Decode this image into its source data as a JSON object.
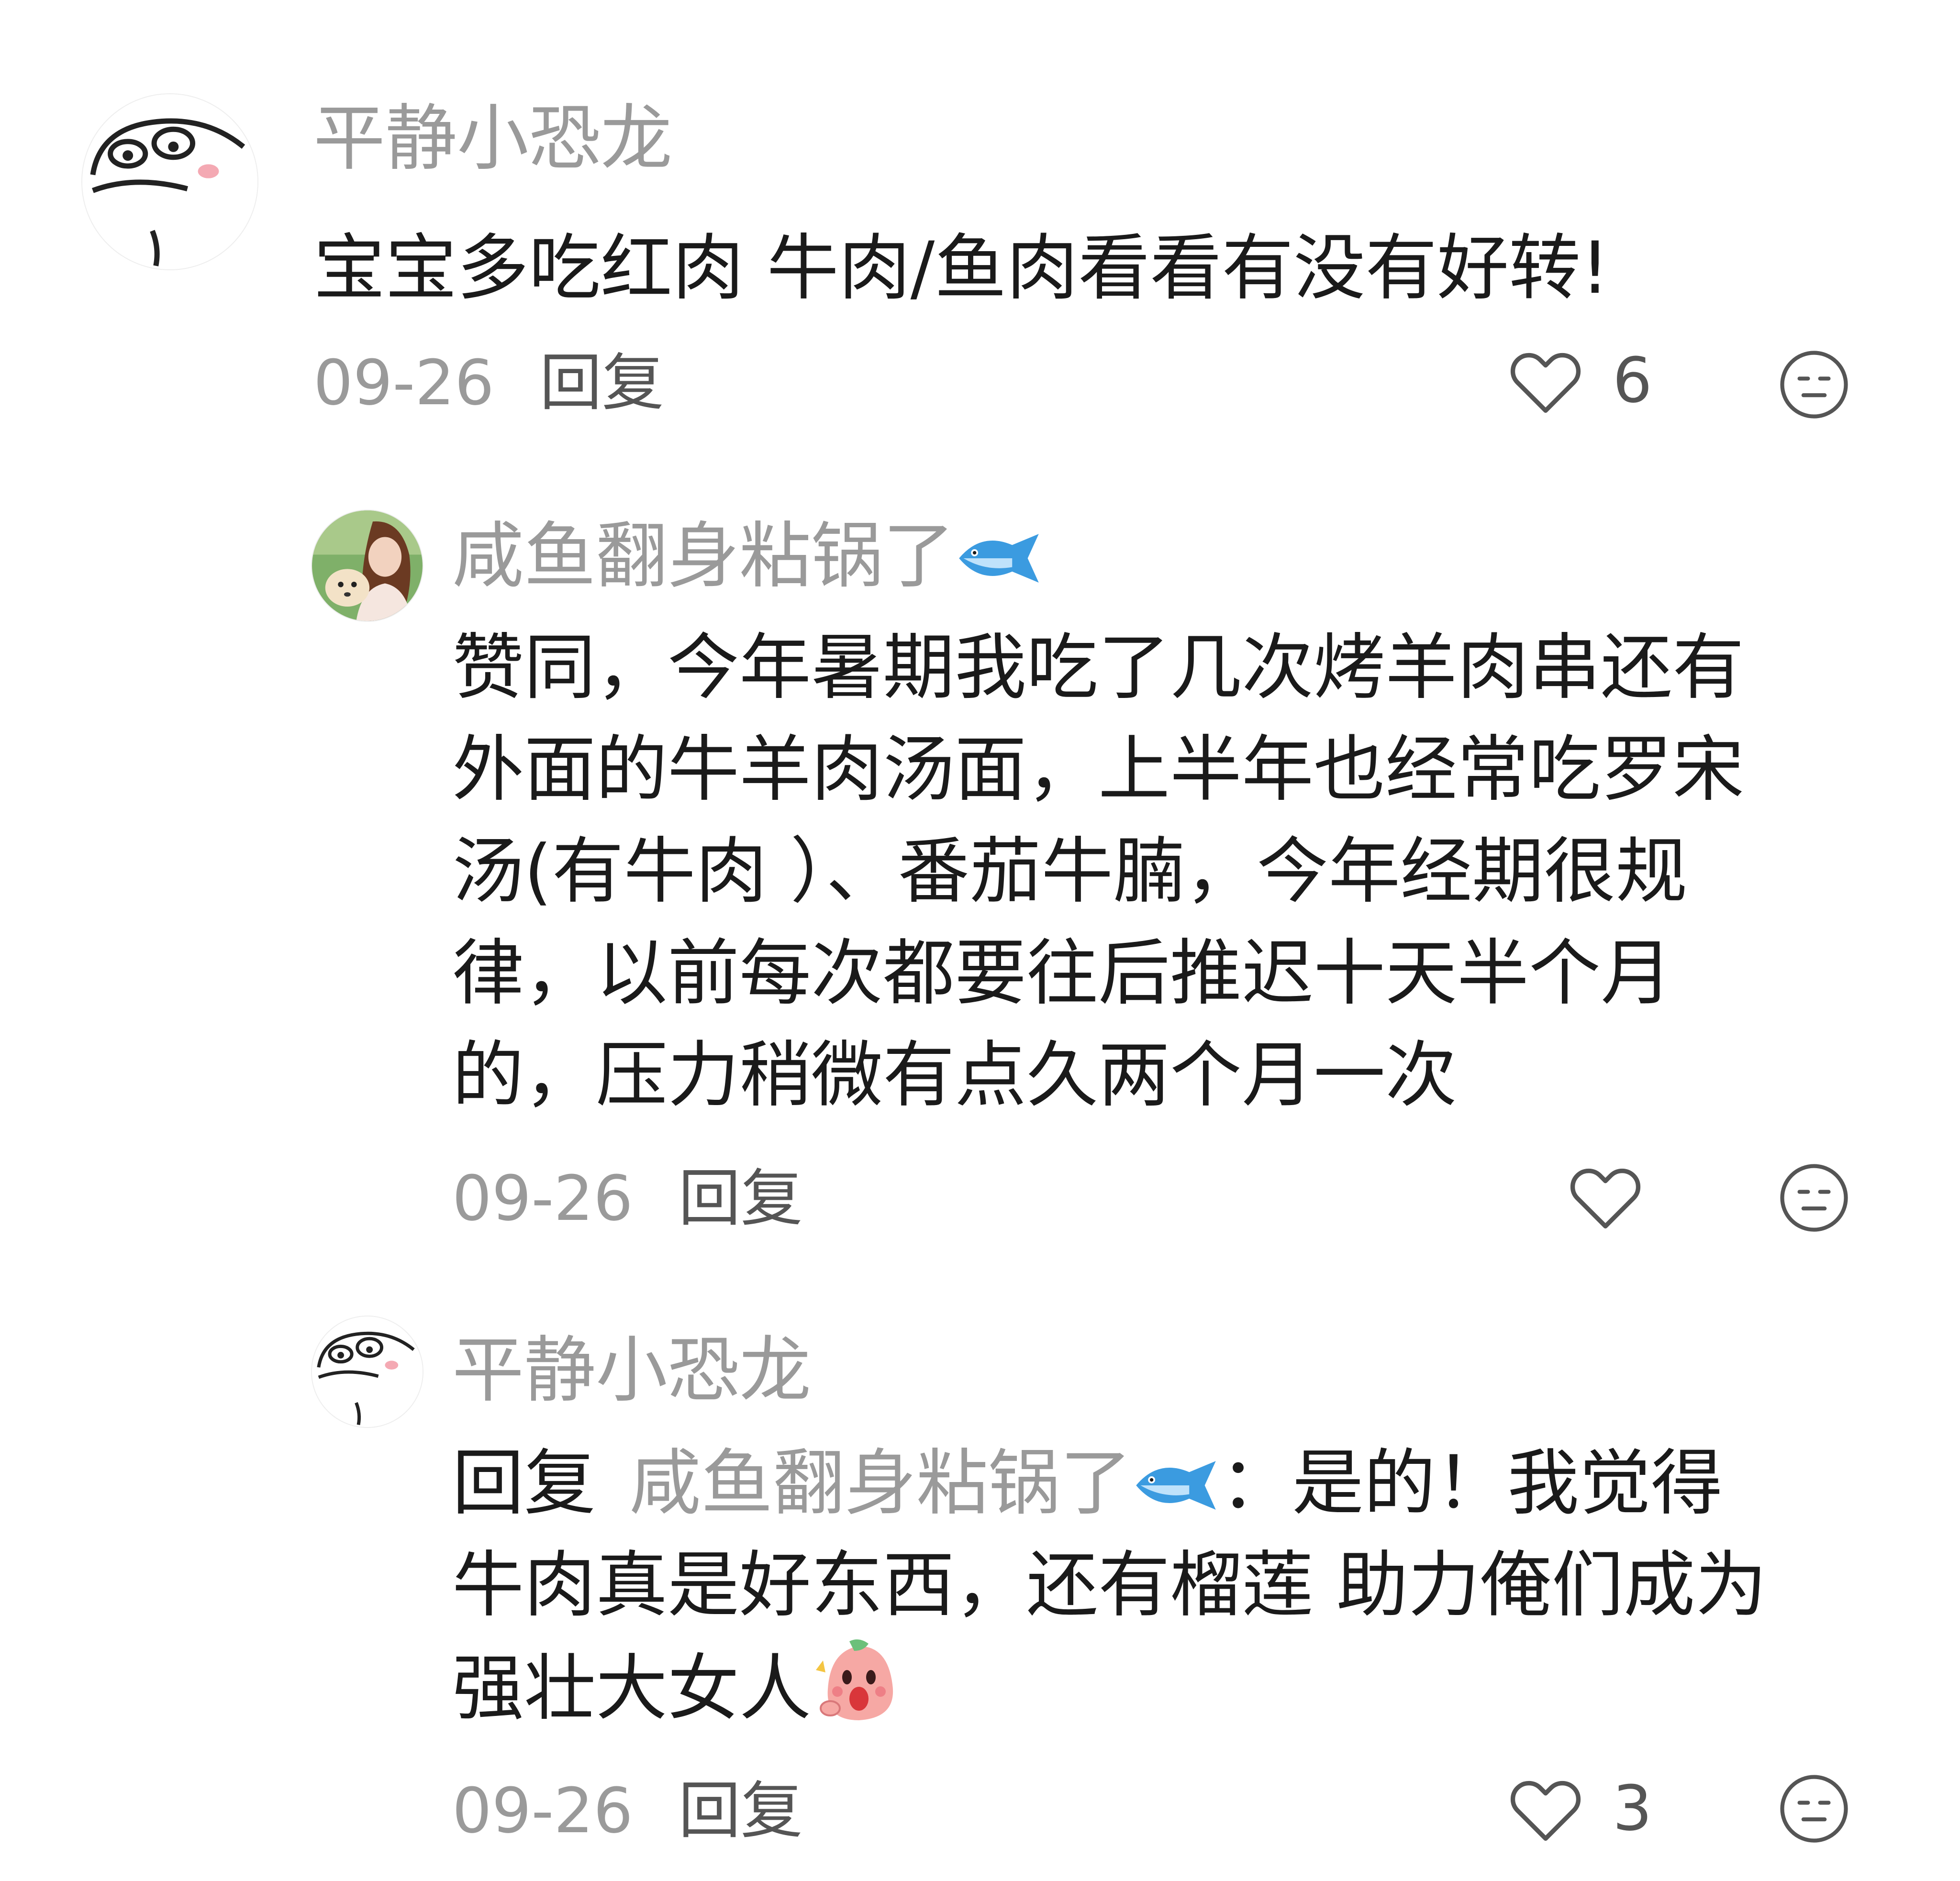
{
  "comments": [
    {
      "username": "平静小恐龙",
      "avatar": "cartoon-bun-face-avatar",
      "text_lines": [
        "宝宝多吃红肉 牛肉/鱼肉看看有没有好转!"
      ],
      "date": "09-26",
      "reply_label": "回复",
      "like_count": "6"
    },
    {
      "username": "咸鱼翻身粘锅了",
      "username_badge": "fish-icon",
      "avatar": "woman-with-dog-photo-avatar",
      "text_lines": [
        "赞同，今年暑期我吃了几次烤羊肉串还有",
        "外面的牛羊肉汤面，上半年也经常吃罗宋",
        "汤(有牛肉 ）、番茄牛腩，今年经期很规",
        "律，以前每次都要往后推迟十天半个月",
        "的，压力稍微有点久两个月一次"
      ],
      "date": "09-26",
      "reply_label": "回复",
      "like_count": ""
    },
    {
      "username": "平静小恐龙",
      "avatar": "cartoon-bun-face-avatar",
      "reply_prefix": "回复",
      "reply_target": "咸鱼翻身粘锅了",
      "reply_target_badge": "fish-icon",
      "text_lines": [
        "：是的！我觉得",
        "牛肉真是好东西，还有榴莲 助力俺们成为",
        "强壮大女人"
      ],
      "text_emoji": "pink-cheering-blob-emoji",
      "date": "09-26",
      "reply_label": "回复",
      "like_count": "3"
    }
  ],
  "icons": {
    "like": "heart-outline-icon",
    "reaction": "neutral-face-icon"
  },
  "colors": {
    "text": "#1a1a1a",
    "muted": "#9a9a9a",
    "icon": "#555555",
    "fish": "#3b9be0"
  }
}
